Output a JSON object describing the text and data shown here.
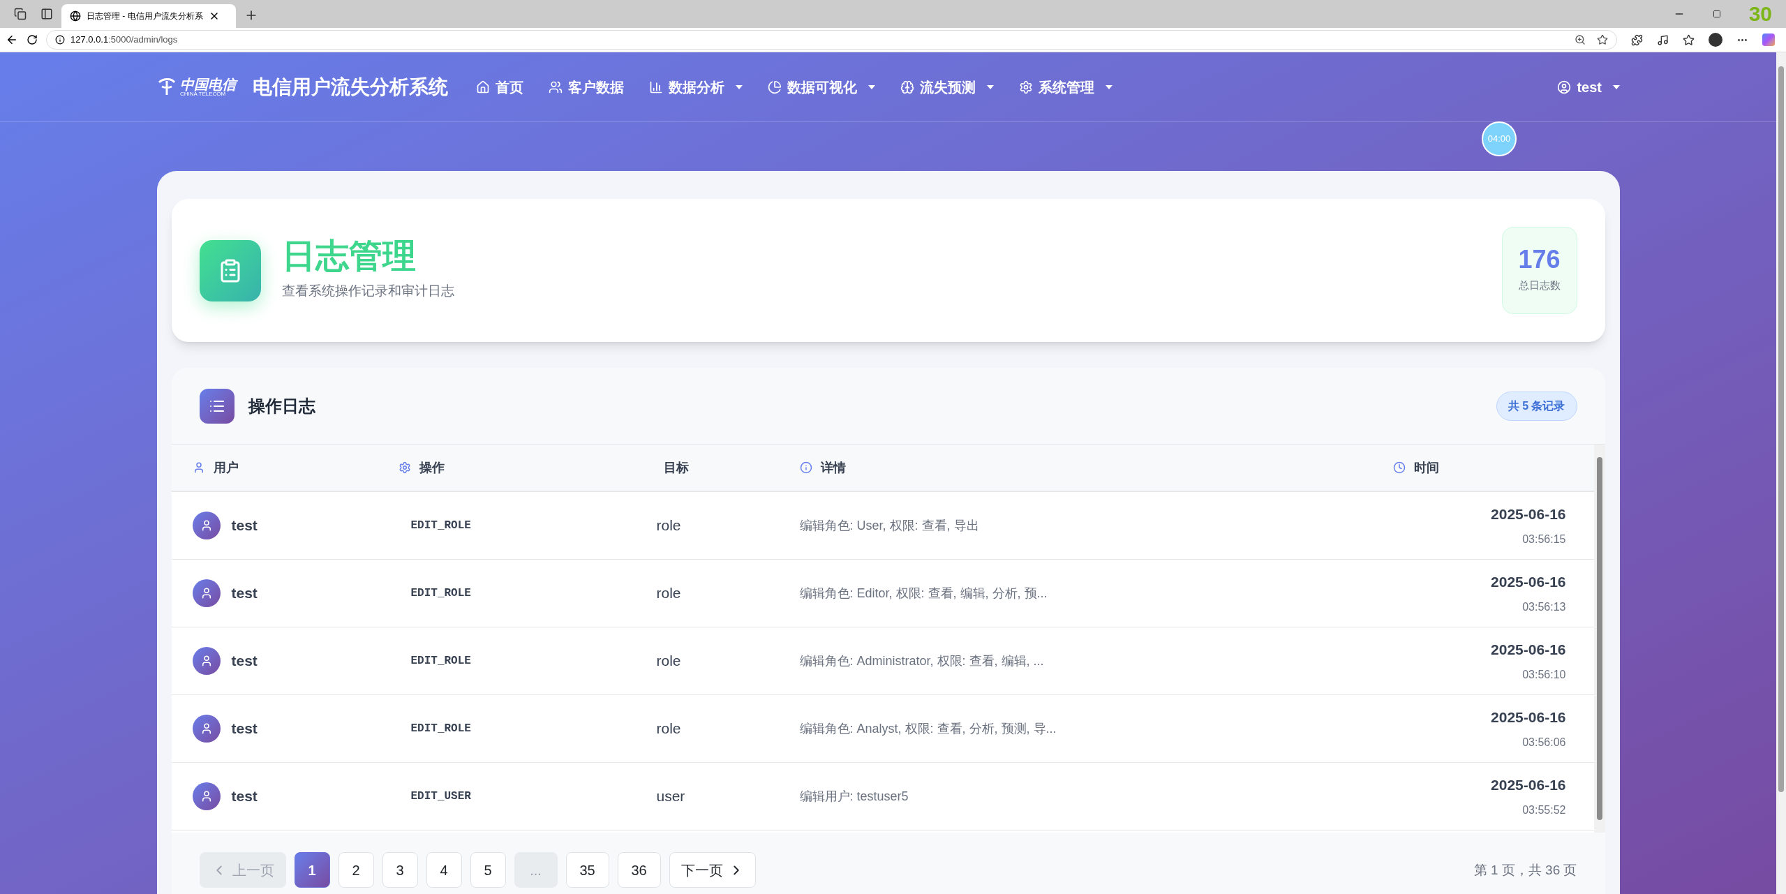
{
  "browser": {
    "tab_title": "日志管理 - 电信用户流失分析系",
    "url_host": "127.0.0.1",
    "url_path": ":5000/admin/logs",
    "overlay_counter": "30"
  },
  "nav": {
    "logo_cn": "中国电信",
    "logo_en": "CHINA TELECOM",
    "brand": "电信用户流失分析系统",
    "items": [
      {
        "label": "首页",
        "dropdown": false
      },
      {
        "label": "客户数据",
        "dropdown": false
      },
      {
        "label": "数据分析",
        "dropdown": true
      },
      {
        "label": "数据可视化",
        "dropdown": true
      },
      {
        "label": "流失预测",
        "dropdown": true
      },
      {
        "label": "系统管理",
        "dropdown": true
      }
    ],
    "user": "test"
  },
  "timer": "04:00",
  "header": {
    "title": "日志管理",
    "subtitle": "查看系统操作记录和审计日志",
    "stat_value": "176",
    "stat_label": "总日志数"
  },
  "log_panel": {
    "title": "操作日志",
    "badge": "共 5 条记录",
    "columns": [
      "用户",
      "操作",
      "目标",
      "详情",
      "时间"
    ],
    "rows": [
      {
        "user": "test",
        "action": "EDIT_ROLE",
        "target": "role",
        "detail": "编辑角色: User, 权限: 查看, 导出",
        "date": "2025-06-16",
        "time": "03:56:15"
      },
      {
        "user": "test",
        "action": "EDIT_ROLE",
        "target": "role",
        "detail": "编辑角色: Editor, 权限: 查看, 编辑, 分析, 预...",
        "date": "2025-06-16",
        "time": "03:56:13"
      },
      {
        "user": "test",
        "action": "EDIT_ROLE",
        "target": "role",
        "detail": "编辑角色: Administrator, 权限: 查看, 编辑, ...",
        "date": "2025-06-16",
        "time": "03:56:10"
      },
      {
        "user": "test",
        "action": "EDIT_ROLE",
        "target": "role",
        "detail": "编辑角色: Analyst, 权限: 查看, 分析, 预测, 导...",
        "date": "2025-06-16",
        "time": "03:56:06"
      },
      {
        "user": "test",
        "action": "EDIT_USER",
        "target": "user",
        "detail": "编辑用户: testuser5",
        "date": "2025-06-16",
        "time": "03:55:52"
      }
    ]
  },
  "pagination": {
    "items": [
      {
        "kind": "prev",
        "label": "上一页",
        "disabled": true
      },
      {
        "kind": "page",
        "label": "1",
        "selected": true
      },
      {
        "kind": "page",
        "label": "2",
        "selected": false
      },
      {
        "kind": "page",
        "label": "3",
        "selected": false
      },
      {
        "kind": "page",
        "label": "4",
        "selected": false
      },
      {
        "kind": "page",
        "label": "5",
        "selected": false
      },
      {
        "kind": "ellipsis",
        "label": "..."
      },
      {
        "kind": "page",
        "label": "35",
        "selected": false
      },
      {
        "kind": "page",
        "label": "36",
        "selected": false
      },
      {
        "kind": "next",
        "label": "下一页",
        "disabled": false
      }
    ],
    "info": "第 1 页，共 36 页"
  }
}
